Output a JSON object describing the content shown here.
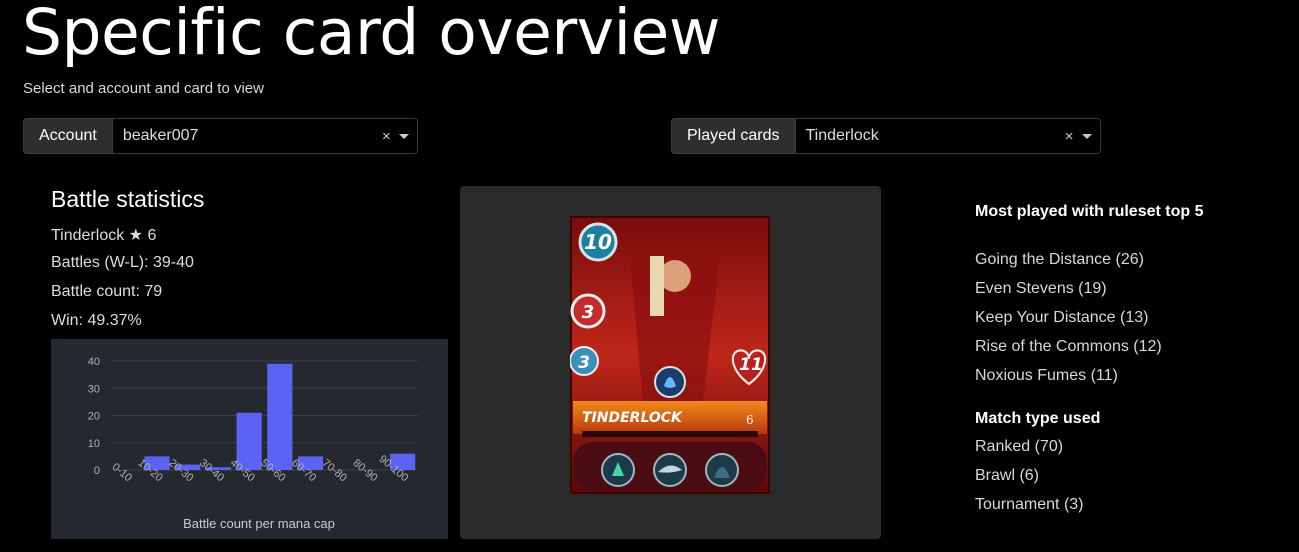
{
  "page": {
    "title": "Specific card overview",
    "subtitle": "Select and account and card to view"
  },
  "account_selector": {
    "label": "Account",
    "value": "beaker007",
    "clear": "×"
  },
  "card_selector": {
    "label": "Played cards",
    "value": "Tinderlock",
    "clear": "×"
  },
  "battle_statistics": {
    "title": "Battle statistics",
    "card_line": "Tinderlock ★ 6",
    "battles": "Battles (W-L): 39-40",
    "battle_count": "Battle count: 79",
    "win": "Win: 49.37%"
  },
  "chart_data": {
    "type": "bar",
    "title": "",
    "xlabel": "Battle count per mana cap",
    "ylabel": "",
    "categories": [
      "0-10",
      "10-20",
      "20-30",
      "30-40",
      "40-50",
      "50-60",
      "60-70",
      "70-80",
      "80-90",
      "90-100"
    ],
    "values": [
      0,
      5,
      2,
      1,
      21,
      39,
      5,
      0,
      0,
      6
    ],
    "ylim": [
      0,
      40
    ],
    "yticks": [
      0,
      10,
      20,
      30,
      40
    ],
    "bar_color": "#5b63f5",
    "grid": true
  },
  "card": {
    "name": "TINDERLOCK",
    "level": "6",
    "mana": "10",
    "melee": "3",
    "speed": "3",
    "health": "11",
    "abilities": [
      "fire-spirit-icon",
      "shark-icon",
      "hooded-figure-icon"
    ]
  },
  "ruleset_top": {
    "heading": "Most played with ruleset top 5",
    "items": [
      "Going the Distance (26)",
      "Even Stevens (19)",
      "Keep Your Distance (13)",
      "Rise of the Commons (12)",
      "Noxious Fumes (11)"
    ]
  },
  "match_types": {
    "heading": "Match type used",
    "items": [
      "Ranked (70)",
      "Brawl (6)",
      "Tournament (3)"
    ]
  }
}
